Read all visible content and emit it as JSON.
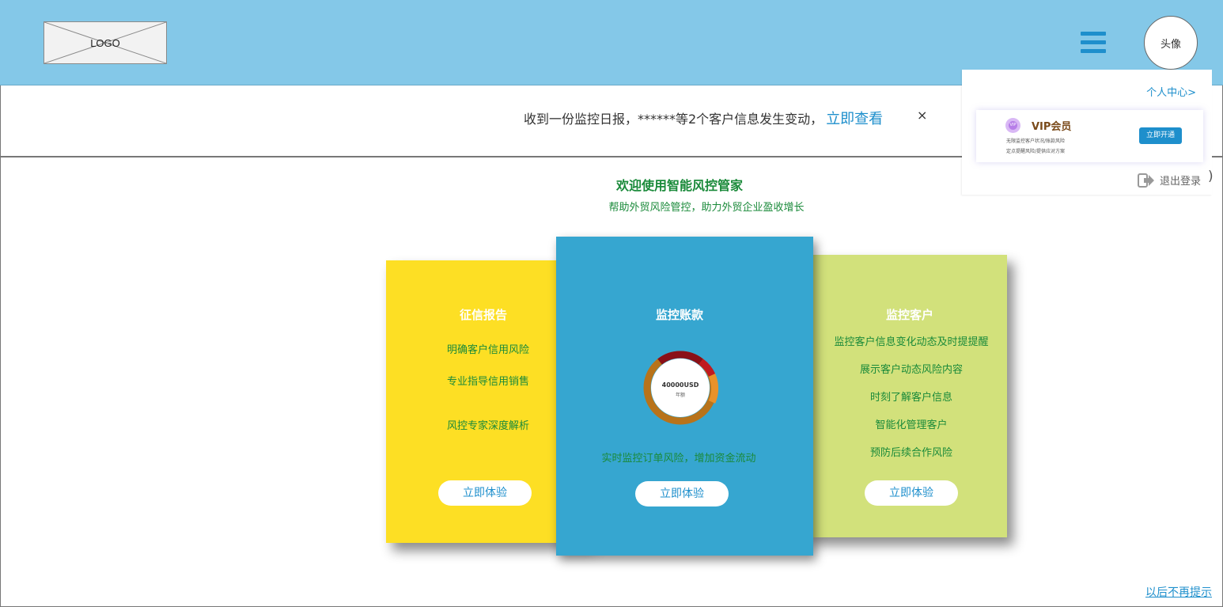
{
  "header": {
    "logo_text": "LOGO",
    "avatar_text": "头像"
  },
  "notice": {
    "message": "收到一份监控日报，******等2个客户信息发生变动，",
    "link": "立即查看",
    "close": "×"
  },
  "main": {
    "title": "欢迎使用智能风控管家",
    "subtitle": "帮助外贸风险管控，助力外贸企业盈收增长",
    "cards": [
      {
        "title": "征信报告",
        "lines": [
          "明确客户信用风险",
          "专业指导信用销售",
          "风控专家深度解析"
        ],
        "button": "立即体验",
        "color": "#fddf24"
      },
      {
        "title": "监控账款",
        "gauge_value": "40000USD",
        "gauge_label": "年额",
        "line": "实时监控订单风险，增加资金流动",
        "button": "立即体验",
        "color": "#36a6d0"
      },
      {
        "title": "监控客户",
        "lines": [
          "监控客户信息变化动态及时提提醒",
          "展示客户动态风险内容",
          "时刻了解客户信息",
          "智能化管理客户",
          "预防后续合作风险"
        ],
        "button": "立即体验",
        "color": "#d2e17b"
      }
    ],
    "dismiss": "以后不再提示"
  },
  "dropdown": {
    "personal_center": "个人中心>",
    "vip_title": "VIP会员",
    "vip_icon_text": "VIP",
    "vip_desc1": "无限监控客户状况/账款风险",
    "vip_desc2": "定点提醒风险/提供应对方案",
    "vip_button": "立即开通",
    "logout": "退出登录"
  },
  "icons": [
    "menu-icon",
    "logout-icon",
    "vip-icon"
  ],
  "colors": {
    "header_bg": "#84c8e8",
    "accent": "#1e8fcc",
    "green_text": "#1a8a3a"
  }
}
